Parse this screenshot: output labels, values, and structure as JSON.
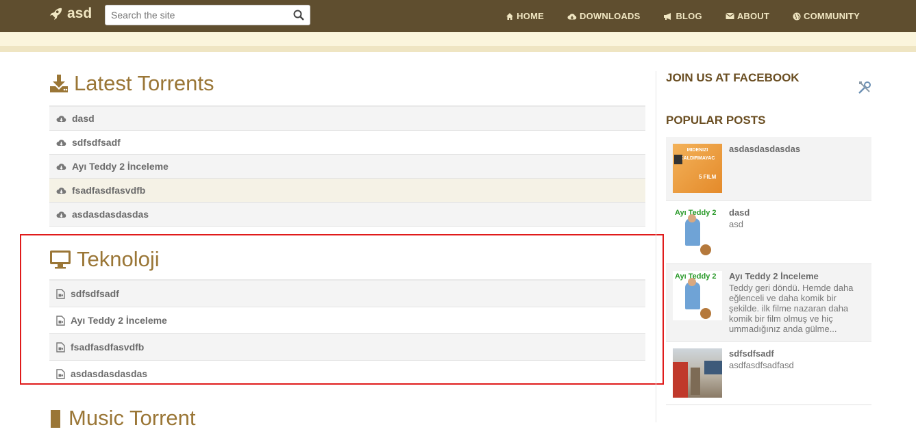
{
  "header": {
    "logo_text": "asd",
    "search_placeholder": "Search the site",
    "nav": [
      {
        "label": "HOME",
        "icon": "home-icon"
      },
      {
        "label": "DOWNLOADS",
        "icon": "cloud-download-icon"
      },
      {
        "label": "BLOG",
        "icon": "bullhorn-icon"
      },
      {
        "label": "ABOUT",
        "icon": "envelope-icon"
      },
      {
        "label": "COMMUNITY",
        "icon": "globe-icon"
      }
    ]
  },
  "sections": {
    "latest": {
      "title": "Latest Torrents",
      "items": [
        "dasd",
        "sdfsdfsadf",
        "Ayı Teddy 2 İnceleme",
        "fsadfasdfasvdfb",
        "asdasdasdasdas"
      ]
    },
    "tech": {
      "title": "Teknoloji",
      "items": [
        "sdfsdfsadf",
        "Ayı Teddy 2 İnceleme",
        "fsadfasdfasvdfb",
        "asdasdasdasdas"
      ]
    },
    "music": {
      "title": "Music Torrent"
    }
  },
  "sidebar": {
    "facebook_heading": "JOIN US AT FACEBOOK",
    "popular_heading": "POPULAR POSTS",
    "posts": [
      {
        "title": "asdasdasdasdas",
        "excerpt": "",
        "thumb_text_1": "MIDENIZI",
        "thumb_text_2": "KALDIRMAYAC",
        "thumb_text_3": "5 FILM"
      },
      {
        "title": "dasd",
        "excerpt": "asd",
        "thumb_text_1": "Ayı Teddy 2"
      },
      {
        "title": "Ayı Teddy 2 İnceleme",
        "excerpt": "Teddy geri döndü. Hemde daha eğlenceli ve daha komik bir şekilde. ilk filme nazaran daha komik bir film olmuş ve hiç ummadığınız anda gülme...",
        "thumb_text_1": "Ayı Teddy 2"
      },
      {
        "title": "sdfsdfsadf",
        "excerpt": "asdfasdfsadfasd"
      }
    ]
  },
  "colors": {
    "header_bg": "#5f4e2f",
    "accent": "#9a7636",
    "highlight_box": "#e01b1b"
  }
}
